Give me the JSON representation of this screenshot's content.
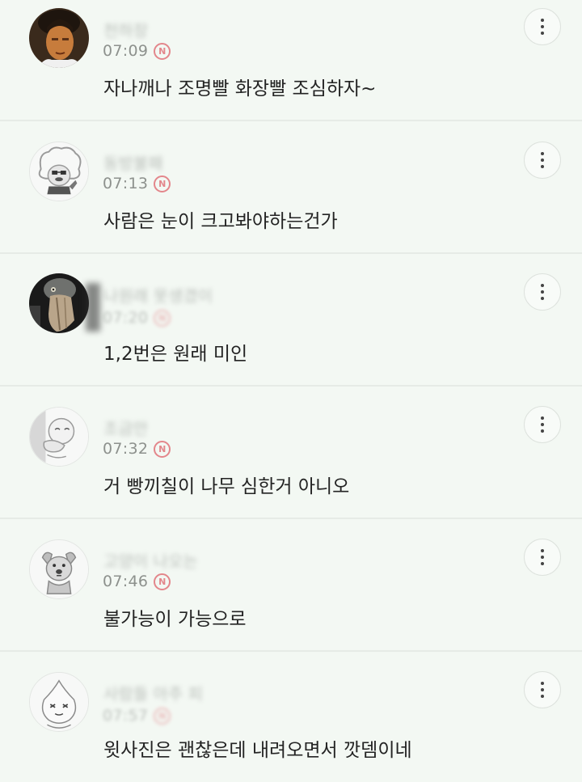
{
  "comments": [
    {
      "avatar_icon": "man-portrait-avatar",
      "nickname": "천하장",
      "time": "07:09",
      "badge": "N",
      "text": "자나깨나 조명빨 화장빨 조심하자~"
    },
    {
      "avatar_icon": "afro-character-avatar",
      "nickname": "동방불패",
      "time": "07:13",
      "badge": "N",
      "text": "사람은 눈이 크고봐야하는건가"
    },
    {
      "avatar_icon": "shoebill-bird-avatar",
      "nickname": "나원래 못생겼이",
      "time": "07:20",
      "badge": "N",
      "text": "1,2번은 원래 미인"
    },
    {
      "avatar_icon": "peeking-character-avatar",
      "nickname": "조금만",
      "time": "07:32",
      "badge": "N",
      "text": "거 빵끼칠이 나무 심한거 아니오"
    },
    {
      "avatar_icon": "dog-character-avatar",
      "nickname": "고양이 나오는",
      "time": "07:46",
      "badge": "N",
      "text": "불가능이 가능으로"
    },
    {
      "avatar_icon": "peach-character-avatar",
      "nickname": "사람들 아주 피",
      "time": "07:57",
      "badge": "N",
      "text": "윗사진은 괜찮은데 내려오면서 깟뎀이네"
    }
  ]
}
